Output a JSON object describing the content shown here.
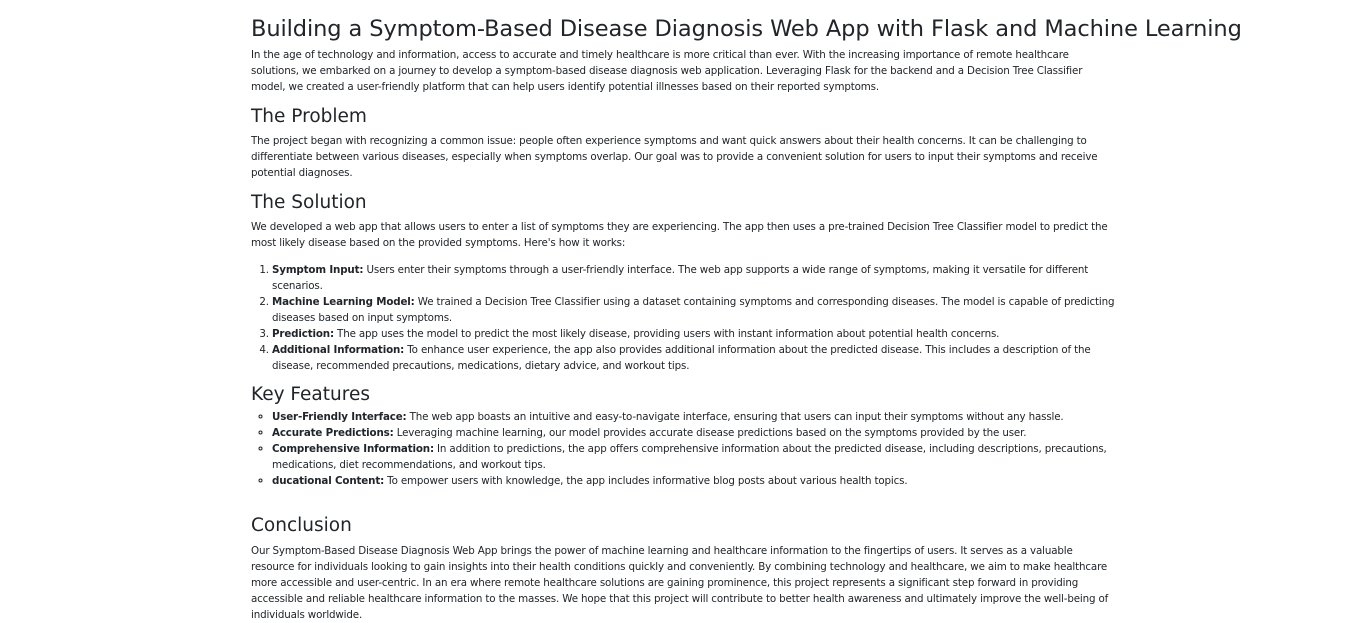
{
  "article": {
    "title": "Building a Symptom-Based Disease Diagnosis Web App with Flask and Machine Learning",
    "intro": "In the age of technology and information, access to accurate and timely healthcare is more critical than ever. With the increasing importance of remote healthcare solutions, we embarked on a journey to develop a symptom-based disease diagnosis web application. Leveraging Flask for the backend and a Decision Tree Classifier model, we created a user-friendly platform that can help users identify potential illnesses based on their reported symptoms.",
    "problem": {
      "heading": "The Problem",
      "text": "The project began with recognizing a common issue: people often experience symptoms and want quick answers about their health concerns. It can be challenging to differentiate between various diseases, especially when symptoms overlap. Our goal was to provide a convenient solution for users to input their symptoms and receive potential diagnoses."
    },
    "solution": {
      "heading": "The Solution",
      "text": "We developed a web app that allows users to enter a list of symptoms they are experiencing. The app then uses a pre-trained Decision Tree Classifier model to predict the most likely disease based on the provided symptoms. Here's how it works:",
      "steps": [
        {
          "label": "Symptom Input:",
          "text": " Users enter their symptoms through a user-friendly interface. The web app supports a wide range of symptoms, making it versatile for different scenarios."
        },
        {
          "label": "Machine Learning Model:",
          "text": " We trained a Decision Tree Classifier using a dataset containing symptoms and corresponding diseases. The model is capable of predicting diseases based on input symptoms."
        },
        {
          "label": "Prediction:",
          "text": " The app uses the model to predict the most likely disease, providing users with instant information about potential health concerns."
        },
        {
          "label": "Additional Information:",
          "text": " To enhance user experience, the app also provides additional information about the predicted disease. This includes a description of the disease, recommended precautions, medications, dietary advice, and workout tips."
        }
      ]
    },
    "features": {
      "heading": "Key Features",
      "items": [
        {
          "label": "User-Friendly Interface:",
          "text": " The web app boasts an intuitive and easy-to-navigate interface, ensuring that users can input their symptoms without any hassle."
        },
        {
          "label": "Accurate Predictions:",
          "text": " Leveraging machine learning, our model provides accurate disease predictions based on the symptoms provided by the user."
        },
        {
          "label": "Comprehensive Information:",
          "text": " In addition to predictions, the app offers comprehensive information about the predicted disease, including descriptions, precautions, medications, diet recommendations, and workout tips."
        },
        {
          "label": "ducational Content:",
          "text": " To empower users with knowledge, the app includes informative blog posts about various health topics."
        }
      ]
    },
    "conclusion": {
      "heading": "Conclusion",
      "text": "Our Symptom-Based Disease Diagnosis Web App brings the power of machine learning and healthcare information to the fingertips of users. It serves as a valuable resource for individuals looking to gain insights into their health conditions quickly and conveniently. By combining technology and healthcare, we aim to make healthcare more accessible and user-centric. In an era where remote healthcare solutions are gaining prominence, this project represents a significant step forward in providing accessible and reliable healthcare information to the masses. We hope that this project will contribute to better health awareness and ultimately improve the well-being of individuals worldwide."
    }
  }
}
